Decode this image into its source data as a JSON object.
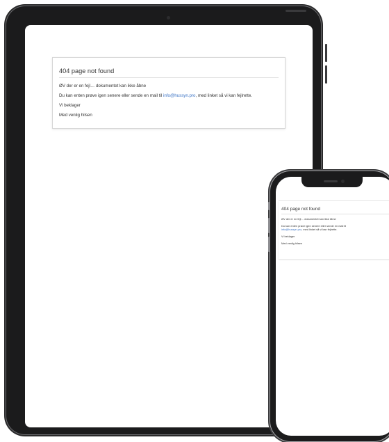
{
  "page": {
    "title": "404 page not found",
    "line1": "ØV der er en fejl… dokumentet kan ikke åbne",
    "line2_before": "Du kan enten prøve igen senere eller sende en mail til ",
    "line2_prefix_short": "Du kan enten prøve igen senere eller sende en mail til",
    "email": "info@hussyn.pro",
    "line2_after": ", med linket så vi kan fejlrette.",
    "line2_after_short": ", med linket så vi kan fejlrette.",
    "line3": "Vi beklager",
    "line4": "Med venlig hilsen"
  }
}
